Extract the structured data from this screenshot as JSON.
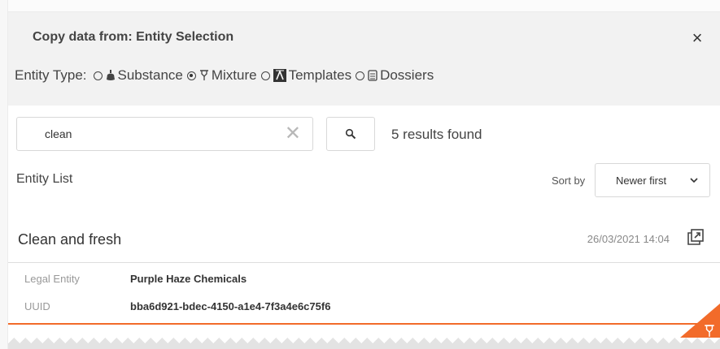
{
  "dialog": {
    "title": "Copy data from: Entity Selection",
    "close_label": "×"
  },
  "entity_type": {
    "label": "Entity Type:",
    "options": [
      {
        "label": "Substance",
        "icon": "flask-icon",
        "selected": false
      },
      {
        "label": "Mixture",
        "icon": "mixture-icon",
        "selected": true
      },
      {
        "label": "Templates",
        "icon": "template-icon",
        "selected": false
      },
      {
        "label": "Dossiers",
        "icon": "dossier-icon",
        "selected": false
      }
    ]
  },
  "search": {
    "value": "clean",
    "clear_label": "✕",
    "results_text": "5 results found"
  },
  "list": {
    "label": "Entity List",
    "sort_label": "Sort by",
    "sort_value": "Newer first"
  },
  "result": {
    "title": "Clean and fresh",
    "date": "26/03/2021 14:04",
    "details": [
      {
        "key": "Legal Entity",
        "value": "Purple Haze Chemicals"
      },
      {
        "key": "UUID",
        "value": "bba6d921-bdec-4150-a1e4-7f3a4e6c75f6"
      }
    ]
  },
  "colors": {
    "accent": "#f26b2a",
    "header_bg": "#f2f2f2"
  }
}
